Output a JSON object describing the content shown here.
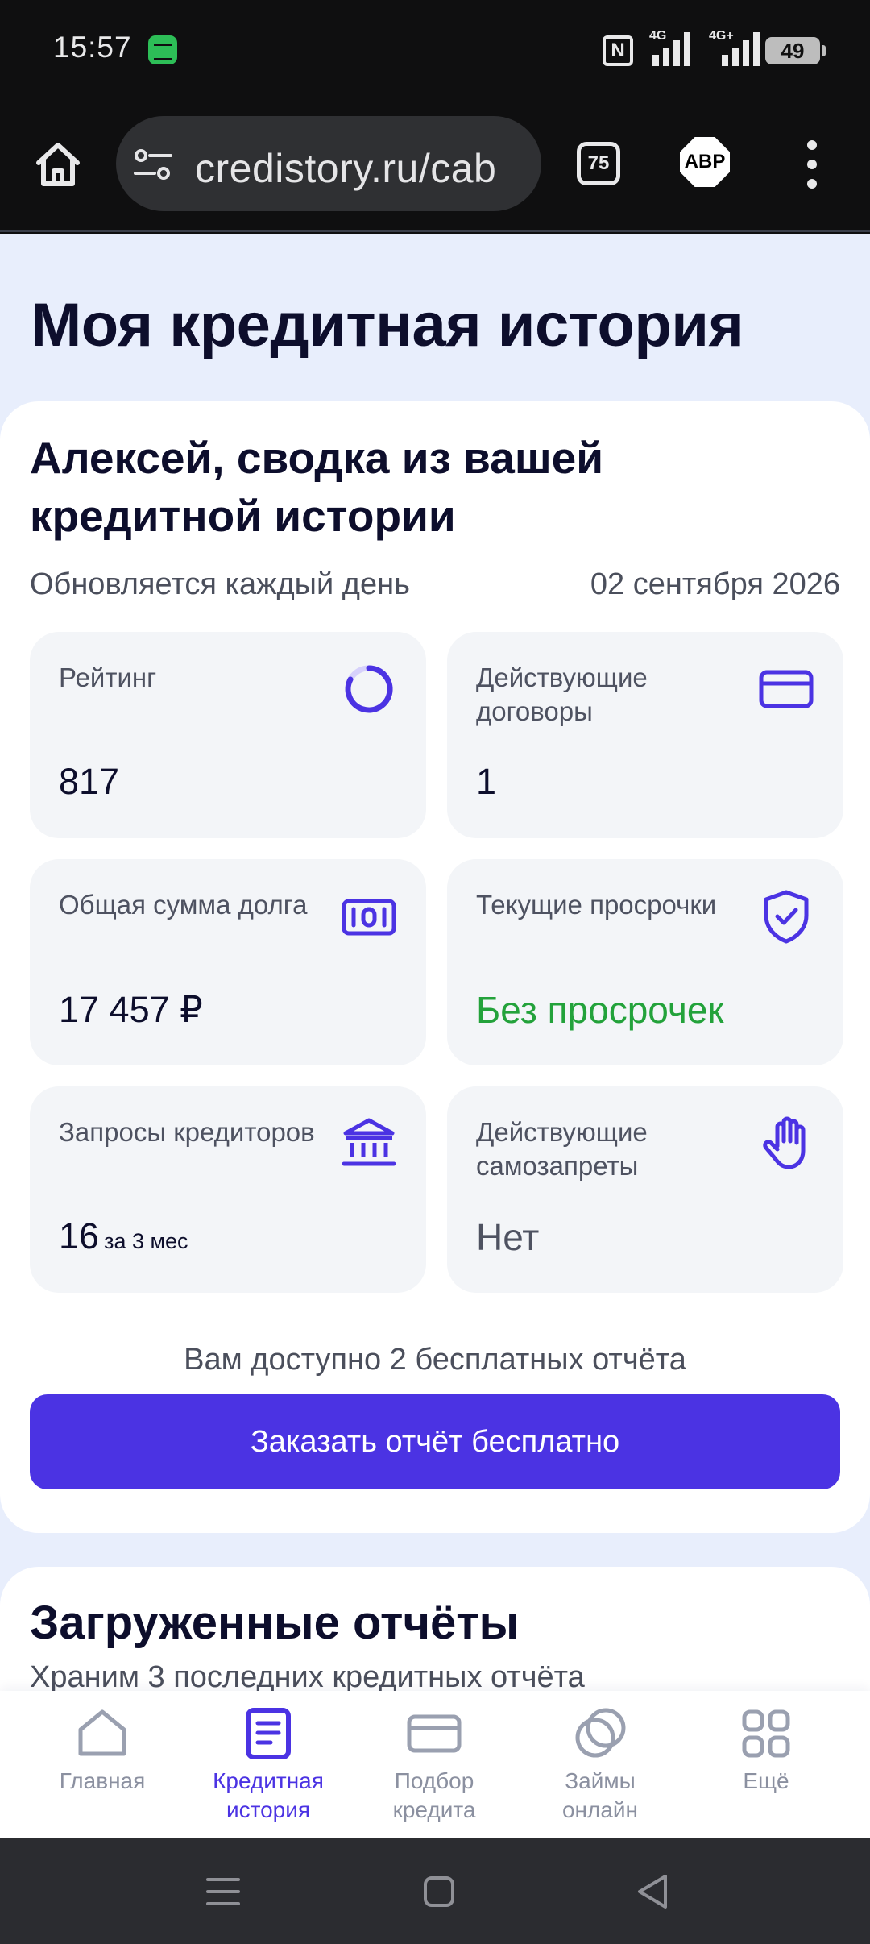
{
  "status_bar": {
    "time": "15:57",
    "network_1": "4G",
    "network_2": "4G+",
    "battery": "49"
  },
  "browser": {
    "url": "credistory.ru/cab",
    "tab_count": "75",
    "adblock_label": "ABP"
  },
  "page": {
    "title": "Моя кредитная история"
  },
  "summary": {
    "title": "Алексей, сводка из вашей кредитной истории",
    "update_note": "Обновляется каждый день",
    "date": "02 сентября 2026",
    "tiles": [
      {
        "label": "Рейтинг",
        "value": "817",
        "icon": "rating-ring-icon"
      },
      {
        "label": "Действующие договоры",
        "value": "1",
        "icon": "card-icon"
      },
      {
        "label": "Общая сумма долга",
        "value": "17 457 ₽",
        "icon": "money-icon"
      },
      {
        "label": "Текущие просрочки",
        "value": "Без просрочек",
        "icon": "shield-check-icon"
      },
      {
        "label": "Запросы кредиторов",
        "value": "16",
        "value_suffix": "за 3 мес",
        "icon": "bank-icon"
      },
      {
        "label": "Действующие самозапреты",
        "value": "Нет",
        "icon": "hand-stop-icon"
      }
    ],
    "free_reports_note": "Вам доступно 2 бесплатных отчёта",
    "order_button": "Заказать отчёт бесплатно"
  },
  "reports": {
    "title": "Загруженные отчёты",
    "subtitle": "Храним 3 последних кредитных отчёта"
  },
  "bottom_nav": {
    "items": [
      {
        "label1": "Главная",
        "label2": ""
      },
      {
        "label1": "Кредитная",
        "label2": "история"
      },
      {
        "label1": "Подбор",
        "label2": "кредита"
      },
      {
        "label1": "Займы",
        "label2": "онлайн"
      },
      {
        "label1": "Ещё",
        "label2": ""
      }
    ],
    "active_index": 1
  },
  "colors": {
    "accent": "#4b33e3",
    "success": "#23a23b",
    "page_background": "#e8eefc",
    "tile_background": "#f3f5f8"
  }
}
